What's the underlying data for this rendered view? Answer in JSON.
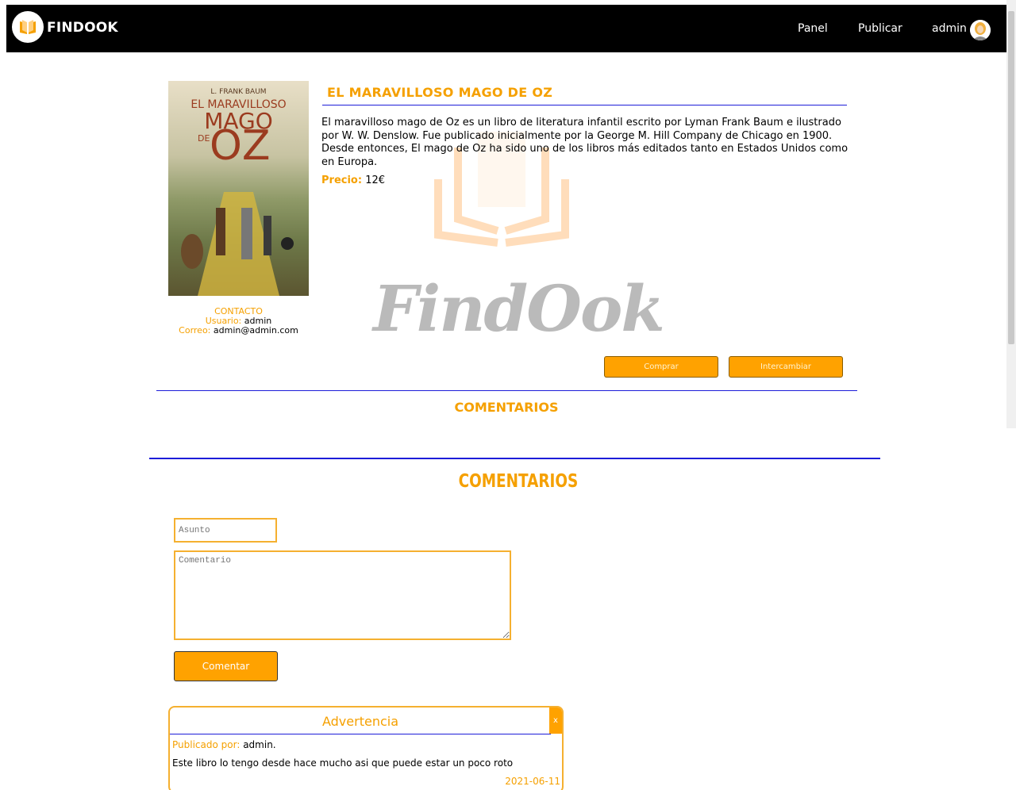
{
  "navbar": {
    "brand": "FINDOOK",
    "links": [
      "Panel",
      "Publicar"
    ],
    "user": "admin",
    "avatar_icon": "user-avatar-icon",
    "logo_icon": "open-book-icon"
  },
  "watermark": {
    "text": "FindOok"
  },
  "book": {
    "cover": {
      "author": "L. FRANK BAUM",
      "title_line1": "EL MARAVILLOSO",
      "title_line2": "MAGO",
      "title_de": "DE",
      "title_oz": "OZ"
    },
    "title": "EL MARAVILLOSO MAGO DE OZ",
    "description": "El maravilloso mago de Oz es un libro de literatura infantil escrito por Lyman Frank Baum e ilustrado por W. W. Denslow. Fue publicado inicialmente por la George M. Hill Company de Chicago en 1900. Desde entonces, El mago de Oz ha sido uno de los libros más editados tanto en Estados Unidos como en Europa.",
    "price_label": "Precio:",
    "price_value": "12€"
  },
  "contact": {
    "heading": "CONTACTO",
    "user_label": "Usuario:",
    "user_value": "admin",
    "email_label": "Correo:",
    "email_value": "admin@admin.com"
  },
  "actions": {
    "buy": "Comprar",
    "exchange": "Intercambiar"
  },
  "comments_heading_1": "COMENTARIOS",
  "comments_heading_2": "COMENTARIOS",
  "form": {
    "subject_placeholder": "Asunto",
    "comment_placeholder": "Comentario",
    "submit": "Comentar"
  },
  "comment_card": {
    "title": "Advertencia",
    "close": "x",
    "posted_by_label": "Publicado por:",
    "posted_by_value": "admin.",
    "text": "Este libro lo tengo desde hace mucho asi que puede estar un poco roto",
    "date": "2021-06-11"
  },
  "colors": {
    "accent": "#f5a000",
    "button": "#ffa200",
    "rule": "#1d1dd9",
    "nav": "#000000"
  }
}
